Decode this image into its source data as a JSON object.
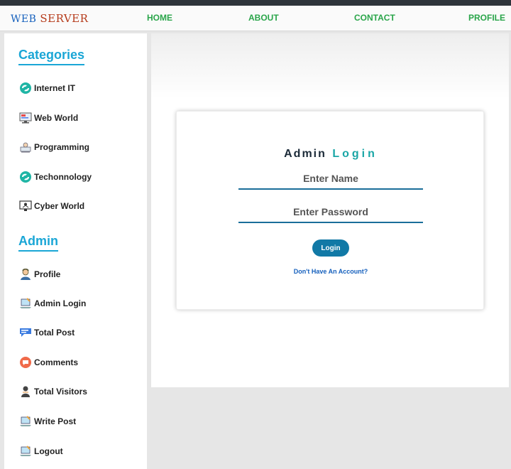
{
  "brand": {
    "word1": "WEB",
    "word2": "SERVER",
    "color1": "#1560bd",
    "color2": "#b53a1a"
  },
  "nav": {
    "home": "HOME",
    "about": "ABOUT",
    "contact": "CONTACT",
    "profile": "PROFILE",
    "color": "#2aa54a"
  },
  "sidebar": {
    "categories_title": "Categories",
    "categories": [
      {
        "label": "Internet IT",
        "icon": "internet-icon"
      },
      {
        "label": "Web World",
        "icon": "monitor-icon"
      },
      {
        "label": "Programming",
        "icon": "programming-icon"
      },
      {
        "label": "Techonnology",
        "icon": "technology-icon"
      },
      {
        "label": "Cyber World",
        "icon": "cyber-icon"
      }
    ],
    "admin_title": "Admin",
    "admin": [
      {
        "label": "Profile",
        "icon": "user-icon"
      },
      {
        "label": "Admin Login",
        "icon": "laptop-icon"
      },
      {
        "label": "Total Post",
        "icon": "blog-icon"
      },
      {
        "label": "Comments",
        "icon": "comment-icon"
      },
      {
        "label": "Total Visitors",
        "icon": "visitor-icon"
      },
      {
        "label": "Write Post",
        "icon": "laptop-icon"
      },
      {
        "label": "Logout",
        "icon": "laptop-icon"
      }
    ],
    "accent": "#1aa6d6"
  },
  "login": {
    "title_part1": "Admin",
    "title_part2": "Login",
    "name_placeholder": "Enter Name",
    "password_placeholder": "Enter Password",
    "button_label": "Login",
    "signup_link": "Don't Have An Account?",
    "button_color": "#1179a6"
  }
}
